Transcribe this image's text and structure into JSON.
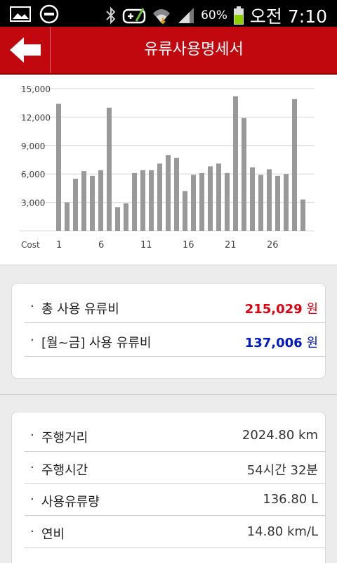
{
  "status_bar": {
    "battery_percent": "60%",
    "clock": "오전 7:10",
    "icons": [
      "gallery-icon",
      "blocked-icon",
      "bluetooth-icon",
      "gamepad-icon",
      "wifi-icon",
      "signal-icon",
      "battery-icon"
    ]
  },
  "header": {
    "title": "유류사용명세서",
    "back_icon": "arrow-left-icon"
  },
  "chart_data": {
    "type": "bar",
    "ylabel": "Cost",
    "y_ticks": [
      "15,000",
      "12,000",
      "9,000",
      "6,000",
      "3,000"
    ],
    "x_ticks": [
      "1",
      "6",
      "11",
      "16",
      "21",
      "26"
    ],
    "x_label": "Cost",
    "ylim": [
      0,
      15000
    ],
    "grid": true,
    "x": [
      1,
      2,
      3,
      4,
      5,
      6,
      7,
      8,
      9,
      10,
      11,
      12,
      13,
      14,
      15,
      16,
      17,
      18,
      19,
      20,
      21,
      22,
      23,
      24,
      25,
      26,
      27,
      28,
      29,
      30
    ],
    "values": [
      13400,
      3000,
      5500,
      6300,
      5800,
      6400,
      13000,
      2500,
      2900,
      6100,
      6400,
      6400,
      7100,
      8000,
      7700,
      4200,
      5900,
      6100,
      6800,
      7100,
      6100,
      14200,
      11900,
      6700,
      5900,
      6500,
      5800,
      6000,
      13900,
      3300
    ],
    "color": "#999999"
  },
  "summary": {
    "total_label": "총 사용 유류비",
    "total_value": "215,029",
    "total_unit": "원",
    "weekday_label": "[월~금] 사용 유류비",
    "weekday_value": "137,006",
    "weekday_unit": "원"
  },
  "details": {
    "distance_label": "주행거리",
    "distance_value": "2024.80 km",
    "time_label": "주행시간",
    "time_value": "54시간 32분",
    "fuel_label": "사용유류량",
    "fuel_value": "136.80 L",
    "efficiency_label": "연비",
    "efficiency_value": "14.80 km/L"
  },
  "bullet": "·",
  "colors": {
    "header": "#c1080e",
    "total_value": "#e0000f",
    "weekday_value": "#0018c8"
  }
}
